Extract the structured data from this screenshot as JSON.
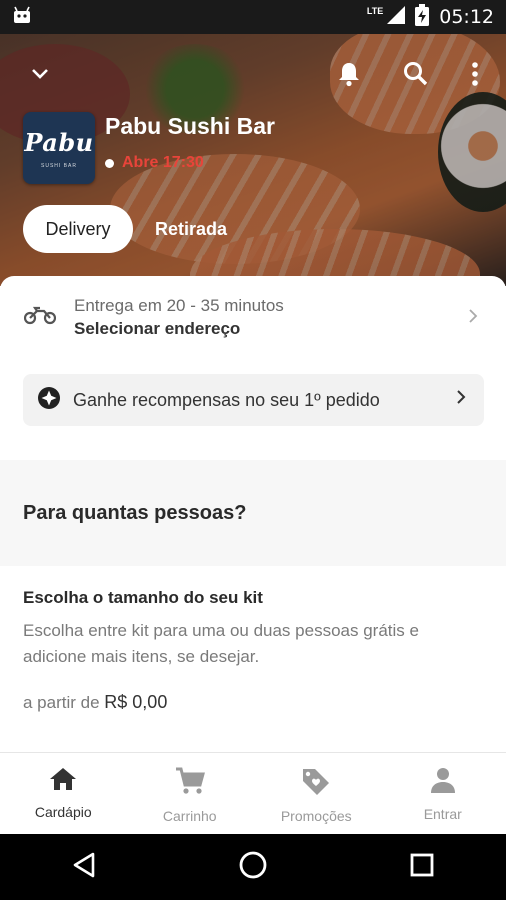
{
  "status_bar": {
    "time": "05:12",
    "network": "LTE",
    "icons": [
      "android-icon",
      "signal-icon",
      "battery-charging-icon"
    ]
  },
  "header": {
    "icons": [
      "chevron-down-icon",
      "bell-icon",
      "search-icon",
      "more-vert-icon"
    ],
    "logo_text": "Pabu",
    "logo_sub": "SUSHI BAR",
    "restaurant_name": "Pabu Sushi Bar",
    "status_text": "Abre 17:30",
    "status_color": "#e8443a"
  },
  "order_mode": {
    "delivery_label": "Delivery",
    "pickup_label": "Retirada",
    "selected": "Delivery"
  },
  "delivery": {
    "icon": "motorcycle-icon",
    "time_text": "Entrega em 20 - 35 minutos",
    "address_cta": "Selecionar endereço"
  },
  "rewards": {
    "icon": "star-badge-icon",
    "text": "Ganhe recompensas no seu 1º pedido"
  },
  "section": {
    "title": "Para quantas pessoas?"
  },
  "kit": {
    "title": "Escolha o tamanho do seu kit",
    "description": "Escolha entre kit para uma ou duas pessoas grátis e adicione mais itens, se desejar.",
    "price_prefix": "a partir de",
    "price_value": "R$ 0,00"
  },
  "bottom_nav": {
    "items": [
      {
        "label": "Cardápio",
        "icon": "home-icon",
        "active": true
      },
      {
        "label": "Carrinho",
        "icon": "cart-icon",
        "active": false
      },
      {
        "label": "Promoções",
        "icon": "tag-heart-icon",
        "active": false
      },
      {
        "label": "Entrar",
        "icon": "person-icon",
        "active": false
      }
    ]
  },
  "system_nav": {
    "icons": [
      "back-icon",
      "home-circle-icon",
      "recents-icon"
    ]
  }
}
